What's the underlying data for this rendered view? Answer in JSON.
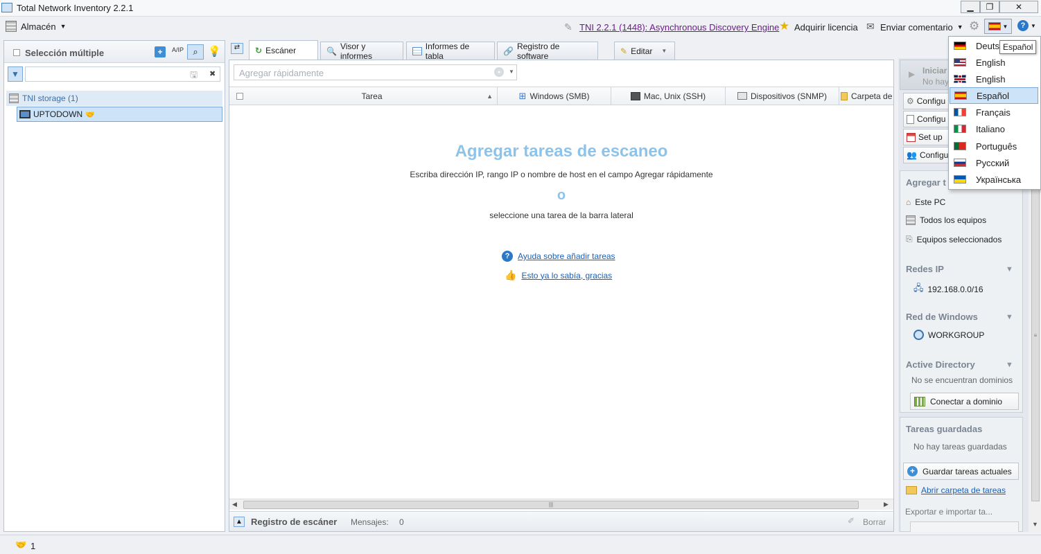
{
  "window": {
    "title": "Total Network Inventory 2.2.1"
  },
  "toolbar": {
    "storage_label": "Almacén",
    "version_link": "TNI 2.2.1 (1448): Asynchronous Discovery Engine",
    "license_label": "Adquirir licencia",
    "feedback_label": "Enviar comentario"
  },
  "left": {
    "multi_select_label": "Selección múltiple",
    "az_label": "A/IP",
    "tree_root": "TNI storage (1)",
    "tree_child": "UPTODOWN"
  },
  "tabs": [
    "Escáner",
    "Visor y informes",
    "Informes de tabla",
    "Registro de software",
    "Editar"
  ],
  "main": {
    "quick_add_placeholder": "Agregar rápidamente",
    "columns": [
      "Tarea",
      "Windows (SMB)",
      "Mac, Unix (SSH)",
      "Dispositivos (SNMP)",
      "Carpeta de"
    ],
    "empty_title": "Agregar tareas de escaneo",
    "empty_line1": "Escriba dirección IP, rango IP o nombre de host en el campo Agregar rápidamente",
    "empty_or": "o",
    "empty_line2": "seleccione una tarea de la barra lateral",
    "help_link": "Ayuda sobre añadir tareas",
    "dismiss_link": "Esto ya lo sabía, gracias",
    "log_label": "Registro de escáner",
    "messages_label": "Mensajes:",
    "messages_count": "0",
    "clear_label": "Borrar"
  },
  "right": {
    "start_label": "Iniciar",
    "no_label": "No hay",
    "config_buttons": [
      "Configu",
      "Configu",
      "Set up",
      "Configu"
    ],
    "add_heading": "Agregar t",
    "items": [
      "Este PC",
      "Todos los equipos",
      "Equipos seleccionados"
    ],
    "ip_heading": "Redes IP",
    "ip_item": "192.168.0.0/16",
    "win_heading": "Red de Windows",
    "win_item": "WORKGROUP",
    "ad_heading": "Active Directory",
    "ad_empty": "No se encuentran dominios",
    "ad_button": "Conectar a dominio",
    "saved_heading": "Tareas guardadas",
    "saved_empty": "No hay tareas guardadas",
    "save_button": "Guardar tareas actuales",
    "open_folder": "Abrir carpeta de tareas",
    "export_label": "Exportar e importar ta..."
  },
  "language_menu": {
    "tooltip": "Español",
    "items": [
      {
        "label": "Deutsch",
        "flag": "de"
      },
      {
        "label": "English",
        "flag": "us"
      },
      {
        "label": "English",
        "flag": "gb"
      },
      {
        "label": "Español",
        "flag": "es"
      },
      {
        "label": "Français",
        "flag": "fr"
      },
      {
        "label": "Italiano",
        "flag": "it"
      },
      {
        "label": "Português",
        "flag": "pt"
      },
      {
        "label": "Русский",
        "flag": "ru"
      },
      {
        "label": "Українська",
        "flag": "ua"
      }
    ],
    "selected_index": 3
  },
  "status": {
    "count": "1"
  }
}
